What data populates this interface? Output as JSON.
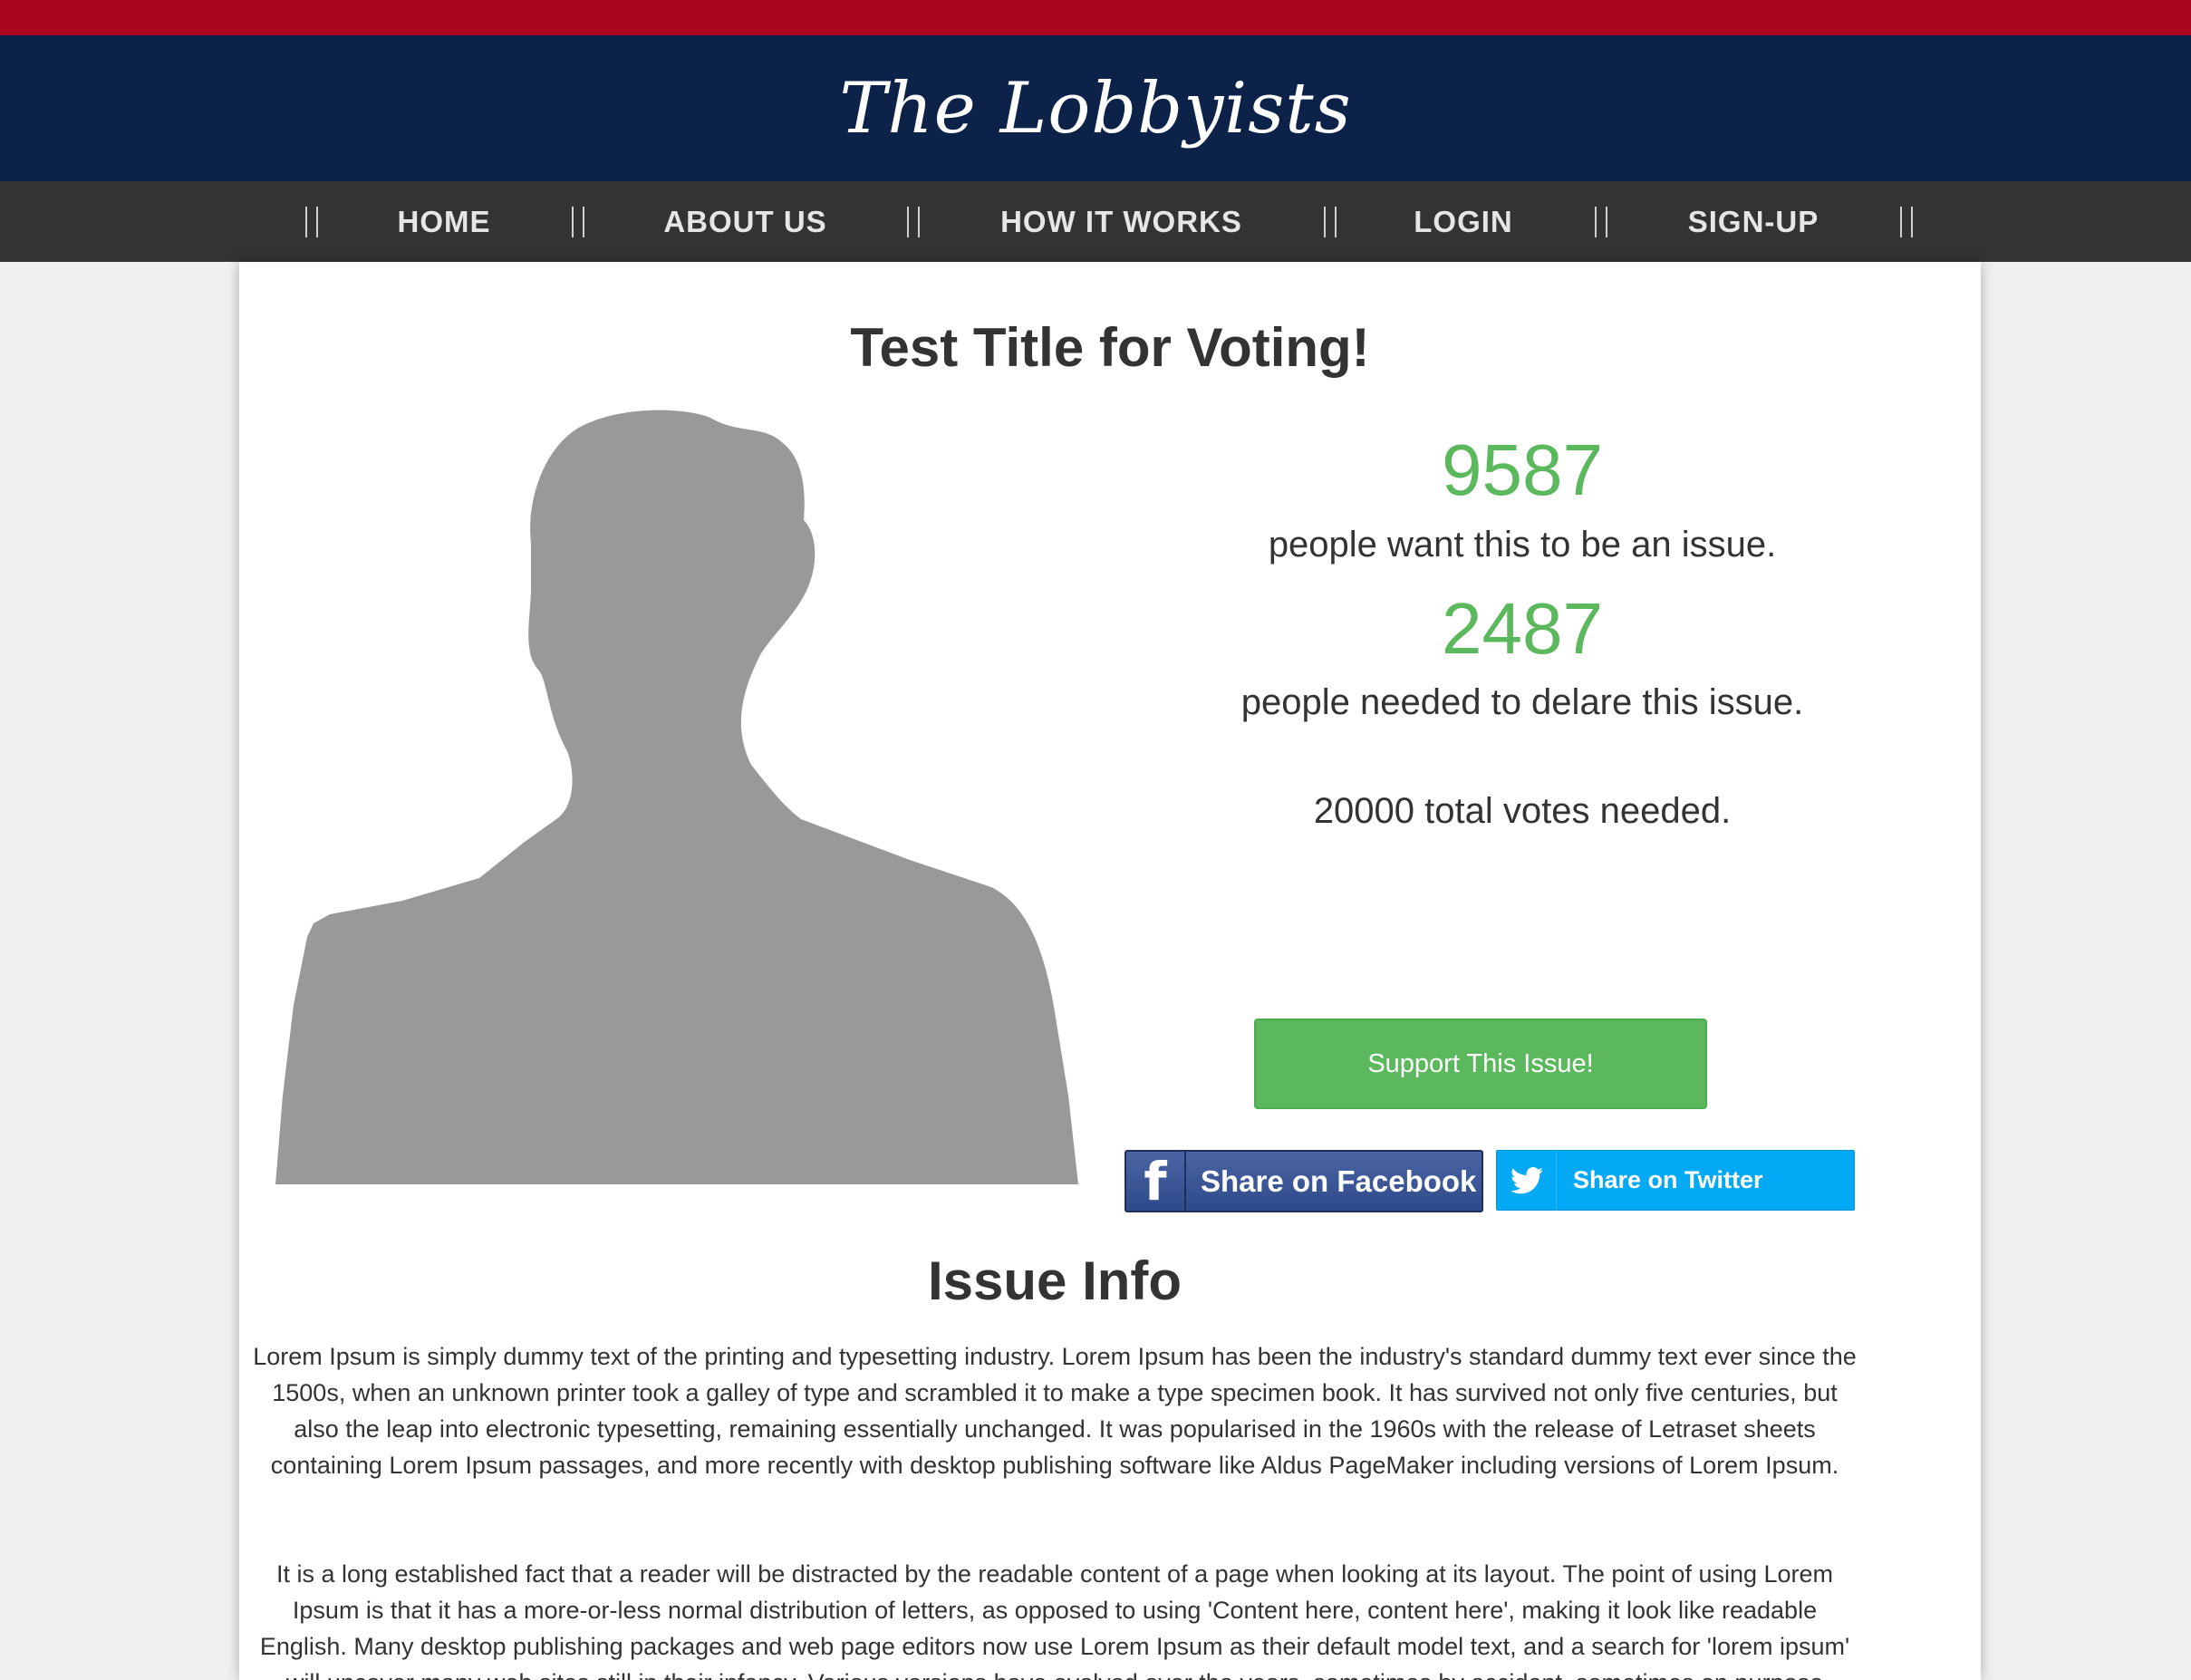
{
  "site": {
    "logo_text": "The Lobbyists"
  },
  "nav": {
    "items": [
      {
        "label": "HOME"
      },
      {
        "label": "ABOUT US"
      },
      {
        "label": "HOW IT WORKS"
      },
      {
        "label": "LOGIN"
      },
      {
        "label": "SIGN-UP"
      }
    ]
  },
  "issue": {
    "title": "Test Title for Voting!",
    "want_count": "9587",
    "want_text": "people want this to be an issue.",
    "needed_count": "2487",
    "needed_text": "people needed to delare this issue.",
    "total_text": "20000 total votes needed.",
    "support_label": "Support This Issue!",
    "facebook_label": "Share on Facebook",
    "twitter_label": "Share on Twitter"
  },
  "info": {
    "title": "Issue Info",
    "paragraphs": [
      "Lorem Ipsum is simply dummy text of the printing and typesetting industry. Lorem Ipsum has been the industry's standard dummy text ever since the 1500s, when an unknown printer took a galley of type and scrambled it to make a type specimen book. It has survived not only five centuries, but also the leap into electronic typesetting, remaining essentially unchanged. It was popularised in the 1960s with the release of Letraset sheets containing Lorem Ipsum passages, and more recently with desktop publishing software like Aldus PageMaker including versions of Lorem Ipsum.",
      "It is a long established fact that a reader will be distracted by the readable content of a page when looking at its layout. The point of using Lorem Ipsum is that it has a more-or-less normal distribution of letters, as opposed to using 'Content here, content here', making it look like readable English. Many desktop publishing packages and web page editors now use Lorem Ipsum as their default model text, and a search for 'lorem ipsum' will uncover many web sites still in their infancy. Various versions have evolved over the years, sometimes by accident, sometimes on purpose (injected humour and the like)."
    ]
  },
  "colors": {
    "top_stripe": "#ab0520",
    "header_bg": "#0c2249",
    "nav_bg": "#333333",
    "accent_green": "#5cb85c",
    "facebook_blue": "#3b5998",
    "twitter_blue": "#03a9f4",
    "silhouette": "#999999"
  },
  "icons": {
    "facebook": "facebook-icon",
    "twitter": "twitter-bird-icon",
    "avatar": "person-silhouette-icon"
  }
}
